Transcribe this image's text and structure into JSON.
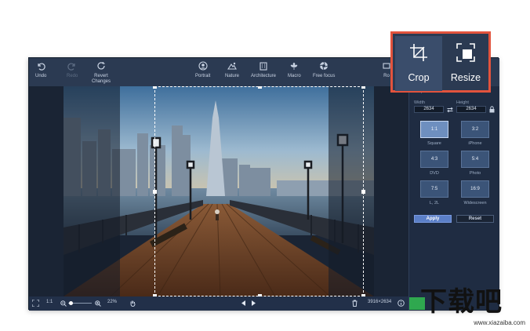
{
  "toolbar": {
    "undo": "Undo",
    "redo": "Redo",
    "revert_line1": "Revert",
    "revert_line2": "Changes",
    "presets": [
      "Portrait",
      "Nature",
      "Architecture",
      "Macro",
      "Free focus"
    ],
    "cut_label": "Ro"
  },
  "callout": {
    "crop": "Crop",
    "resize": "Resize"
  },
  "panel": {
    "section": "Crop",
    "width_label": "Width",
    "height_label": "Height",
    "width_value": "2634",
    "height_value": "2634",
    "ratios": [
      {
        "value": "1:1",
        "caption": "Square",
        "active": true
      },
      {
        "value": "3:2",
        "caption": "iPhone",
        "active": false
      },
      {
        "value": "4:3",
        "caption": "DVD",
        "active": false
      },
      {
        "value": "5:4",
        "caption": "Photo",
        "active": false
      },
      {
        "value": "7:5",
        "caption": "L, 2L",
        "active": false
      },
      {
        "value": "16:9",
        "caption": "Widescreen",
        "active": false
      }
    ],
    "apply": "Apply",
    "reset": "Reset"
  },
  "statusbar": {
    "fit": "1:1",
    "zoom": "22%",
    "dimensions": "3916×2634"
  },
  "watermark": {
    "brand": "下载吧",
    "url": "www.xiazaiba.com"
  },
  "colors": {
    "accent": "#5b7fc7",
    "callout_border": "#e2533d",
    "toolbar": "#2b3a52",
    "panel": "#1f2c42"
  }
}
